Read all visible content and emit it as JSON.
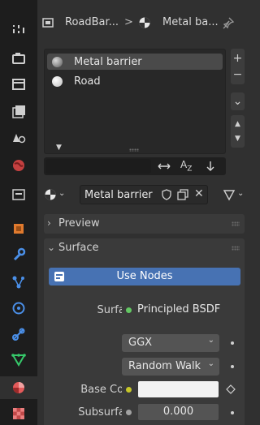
{
  "header": {
    "object_name": "RoadBar...",
    "separator": ">",
    "material_name": "Metal ba..."
  },
  "slot_list": {
    "items": [
      {
        "label": "Metal barrier",
        "selected": true
      },
      {
        "label": "Road",
        "selected": false
      }
    ]
  },
  "material_selector": {
    "name": "Metal barrier"
  },
  "panels": {
    "preview_label": "Preview",
    "surface_label": "Surface"
  },
  "surface": {
    "use_nodes_label": "Use Nodes",
    "surface_label": "Surface",
    "surface_value": "Principled BSDF",
    "distribution_value": "GGX",
    "subsurface_method_value": "Random Walk",
    "base_color_label": "Base Color",
    "base_color_value": "#f2f2f2",
    "subsurface_label": "Subsurface",
    "subsurface_value": "0.000"
  },
  "colors": {
    "accent_blue": "#4772b3",
    "socket_green": "#63c763",
    "socket_yellow": "#c7c729",
    "socket_gray": "#a1a1a1"
  },
  "tabs": [
    "tool-icon",
    "render-icon",
    "output-icon",
    "view-layer-icon",
    "scene-icon",
    "world-icon",
    "collection-icon",
    "object-icon",
    "modifier-icon",
    "particles-icon",
    "physics-icon",
    "constraints-icon",
    "data-icon",
    "material-icon",
    "texture-icon"
  ]
}
